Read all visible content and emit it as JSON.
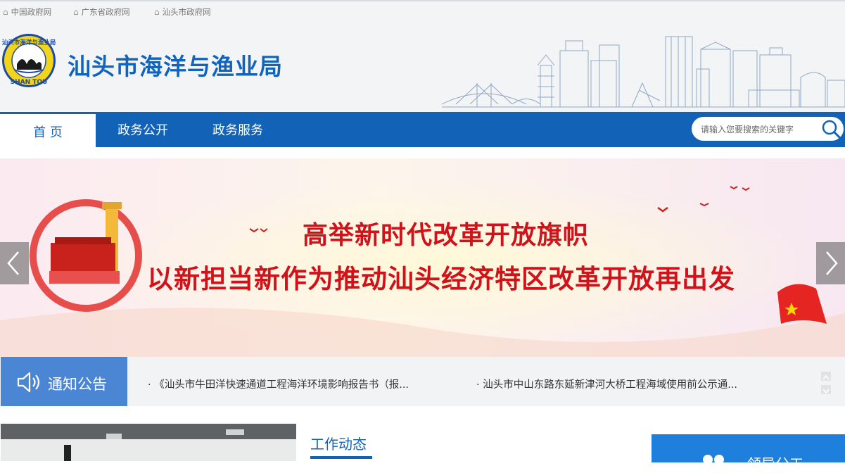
{
  "top_links": [
    "中国政府网",
    "广东省政府网",
    "汕头市政府网"
  ],
  "header": {
    "logo_text_top": "汕头市海洋与渔业局",
    "logo_text_bottom": "SHAN TOU",
    "site_title": "汕头市海洋与渔业局"
  },
  "nav": {
    "items": [
      "首 页",
      "政务公开",
      "政务服务"
    ],
    "search_placeholder": "请输入您要搜索的关键字"
  },
  "banner": {
    "line1": "高举新时代改革开放旗帜",
    "line2": "以新担当新作为推动汕头经济特区改革开放再出发"
  },
  "notice": {
    "label": "通知公告",
    "items": [
      "· 《汕头市牛田洋快速通道工程海洋环境影响报告书（报...",
      "· 汕头市中山东路东延新津河大桥工程海域使用前公示通..."
    ]
  },
  "sections": {
    "work_title": "工作动态",
    "leader_label": "领导分工"
  },
  "colors": {
    "brand_blue": "#1263b8",
    "notice_blue": "#4b86d4",
    "banner_red": "#d0131a"
  }
}
